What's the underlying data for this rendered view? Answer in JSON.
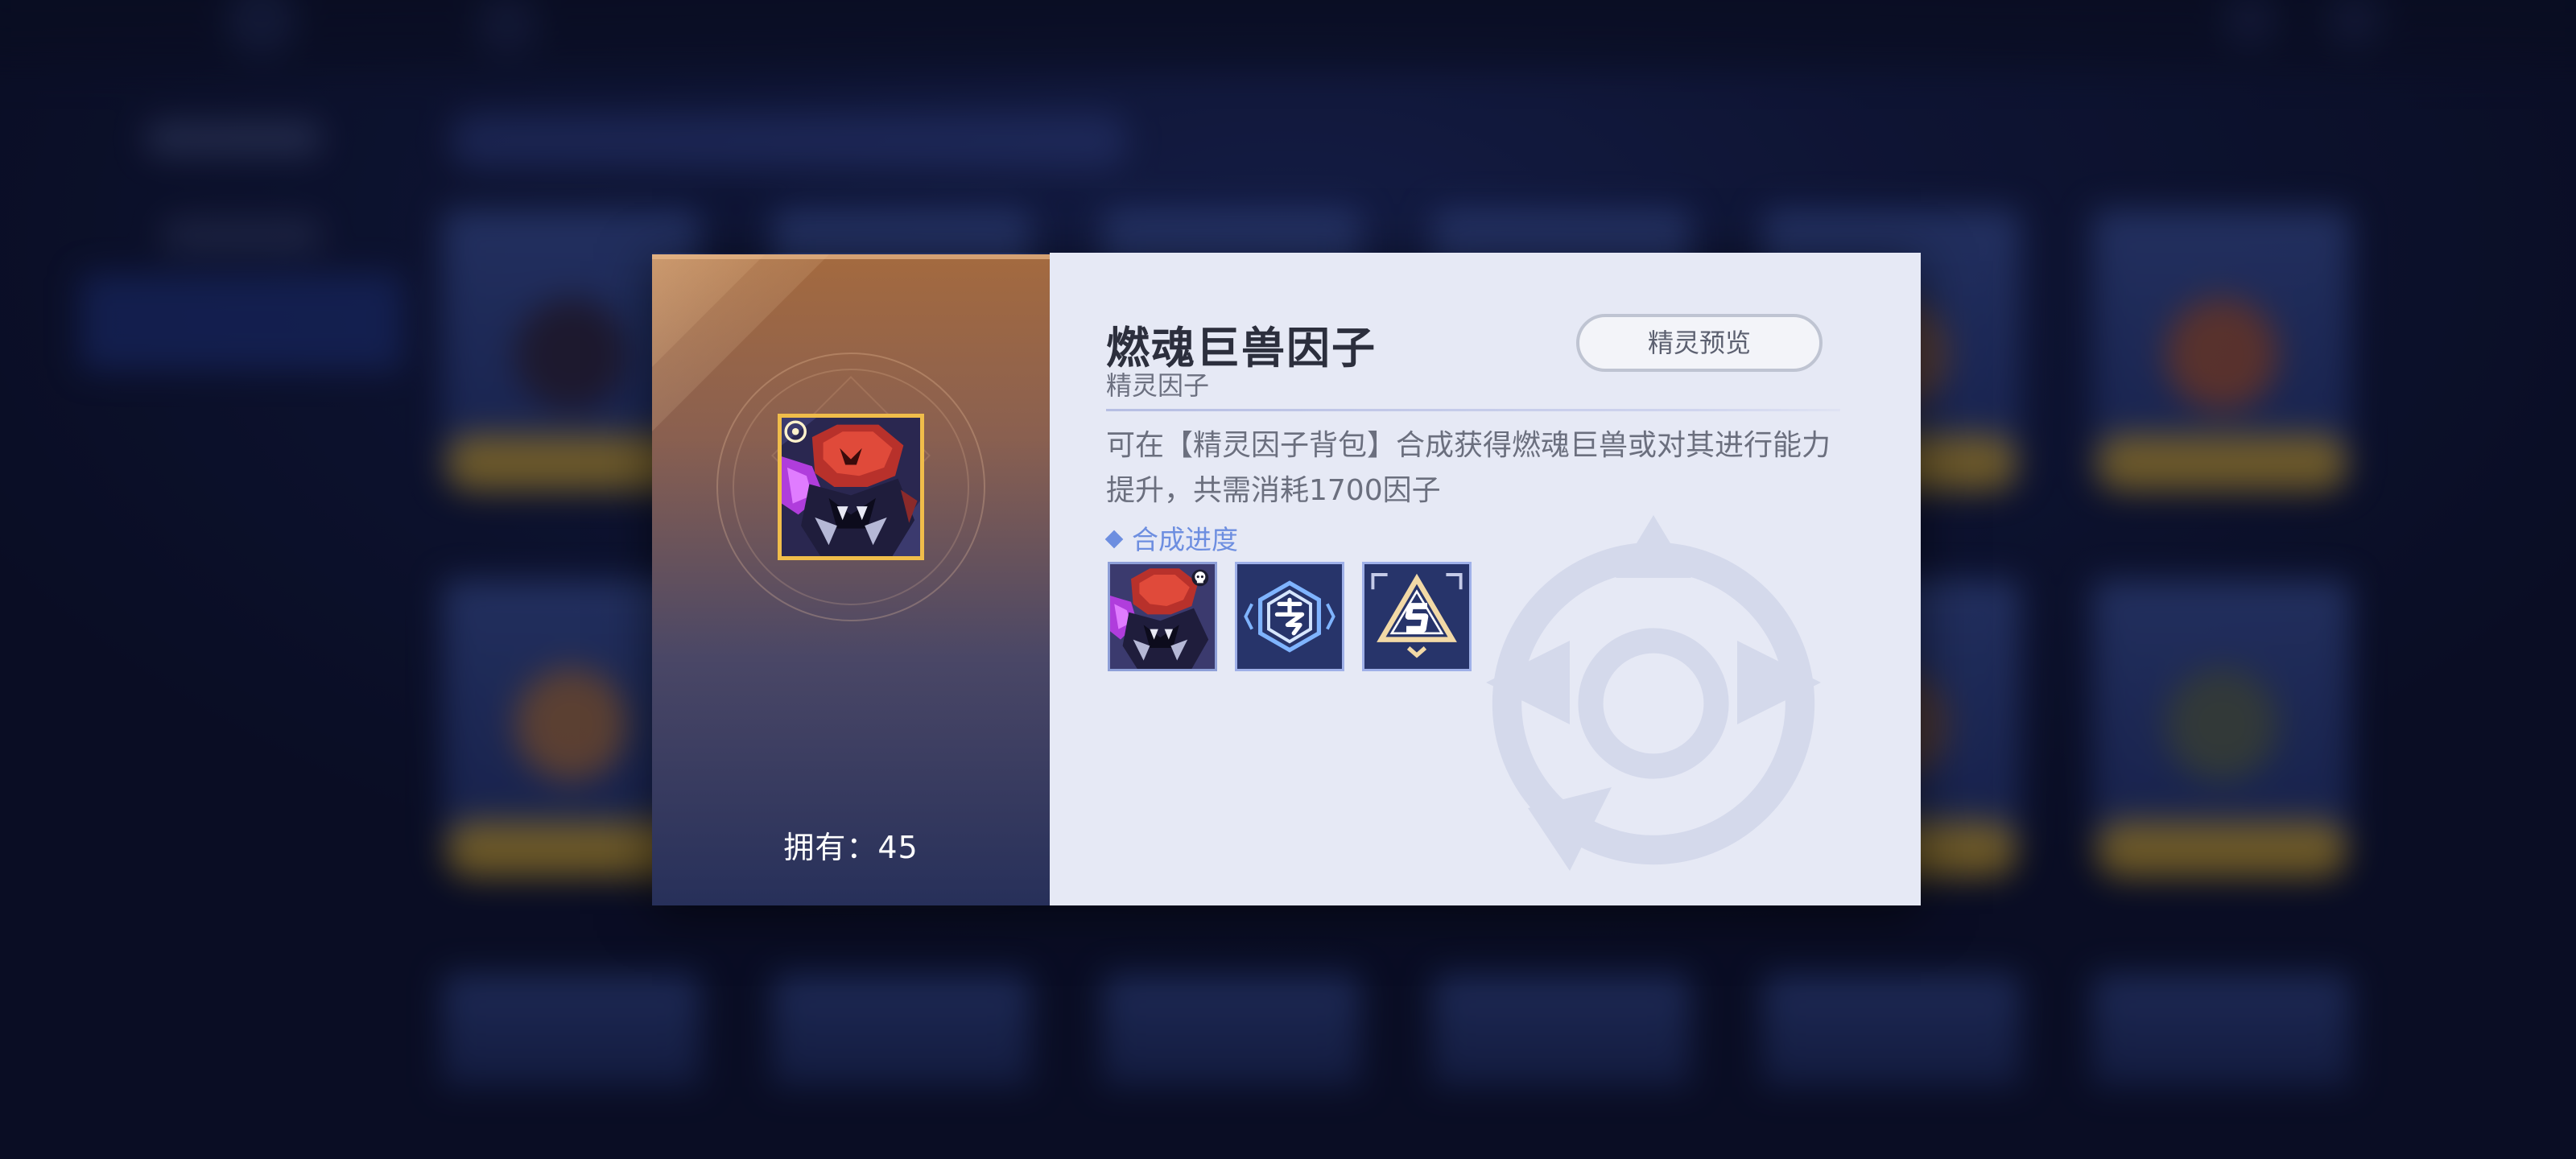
{
  "item": {
    "name": "燃魂巨兽因子",
    "category": "精灵因子",
    "owned_text": "拥有：45",
    "description": "可在【精灵因子背包】合成获得燃魂巨兽或对其进行能力提升，共需消耗1700因子"
  },
  "actions": {
    "preview_label": "精灵预览"
  },
  "progress": {
    "label": "合成进度",
    "slots": [
      {
        "icon": "monster-portrait-icon",
        "badge": "skull-badge-icon"
      },
      {
        "icon": "exclusive-hexagon-icon"
      },
      {
        "icon": "s-rank-triangle-icon"
      }
    ]
  },
  "colors": {
    "accent_gold": "#f0bd4a",
    "progress_blue": "#6d8ee0",
    "slot_navy": "#27346a"
  }
}
